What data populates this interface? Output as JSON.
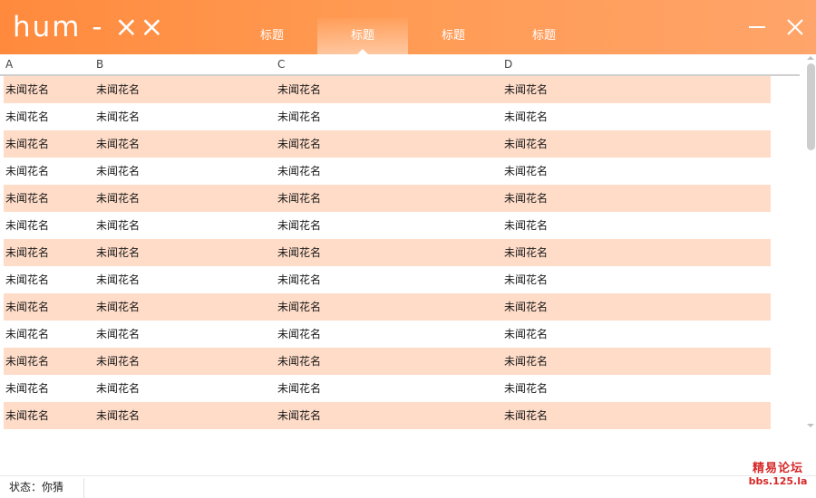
{
  "window": {
    "title": "hum - ××"
  },
  "tabs": [
    {
      "label": "标题",
      "active": false
    },
    {
      "label": "标题",
      "active": true
    },
    {
      "label": "标题",
      "active": false
    },
    {
      "label": "标题",
      "active": false
    }
  ],
  "window_controls": {
    "minimize_icon": "minimize-icon",
    "close_icon": "close-icon"
  },
  "grid": {
    "columns": [
      "A",
      "B",
      "C",
      "D"
    ],
    "rows": [
      [
        "未闻花名",
        "未闻花名",
        "未闻花名",
        "未闻花名"
      ],
      [
        "未闻花名",
        "未闻花名",
        "未闻花名",
        "未闻花名"
      ],
      [
        "未闻花名",
        "未闻花名",
        "未闻花名",
        "未闻花名"
      ],
      [
        "未闻花名",
        "未闻花名",
        "未闻花名",
        "未闻花名"
      ],
      [
        "未闻花名",
        "未闻花名",
        "未闻花名",
        "未闻花名"
      ],
      [
        "未闻花名",
        "未闻花名",
        "未闻花名",
        "未闻花名"
      ],
      [
        "未闻花名",
        "未闻花名",
        "未闻花名",
        "未闻花名"
      ],
      [
        "未闻花名",
        "未闻花名",
        "未闻花名",
        "未闻花名"
      ],
      [
        "未闻花名",
        "未闻花名",
        "未闻花名",
        "未闻花名"
      ],
      [
        "未闻花名",
        "未闻花名",
        "未闻花名",
        "未闻花名"
      ],
      [
        "未闻花名",
        "未闻花名",
        "未闻花名",
        "未闻花名"
      ],
      [
        "未闻花名",
        "未闻花名",
        "未闻花名",
        "未闻花名"
      ],
      [
        "未闻花名",
        "未闻花名",
        "未闻花名",
        "未闻花名"
      ]
    ],
    "stripe_color": "#ffdcc8"
  },
  "status": {
    "text": "状态：你猜"
  },
  "watermark": {
    "line1": "精易论坛",
    "line2": "bbs.125.la"
  },
  "colors": {
    "titlebar_start": "#ff8a3d",
    "titlebar_end": "#ffa46a",
    "watermark": "#d62828"
  }
}
